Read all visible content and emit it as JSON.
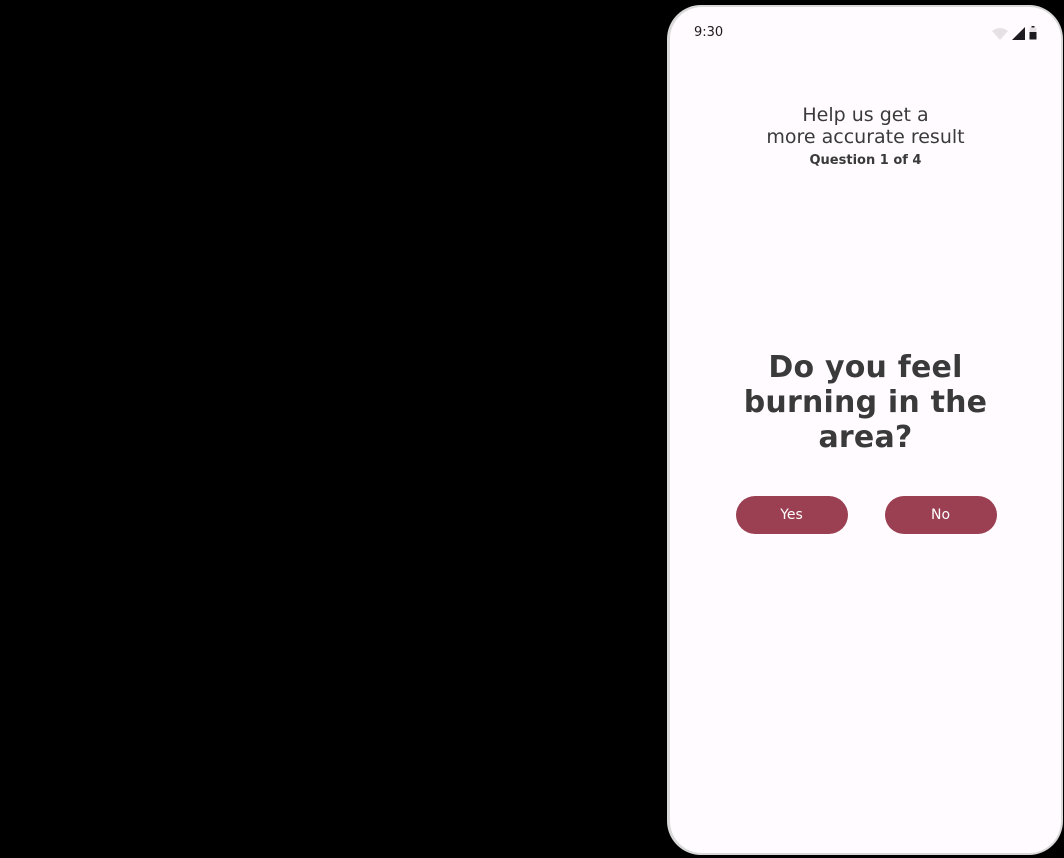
{
  "status_bar": {
    "time": "9:30",
    "icons": [
      "wifi-icon",
      "signal-icon",
      "battery-icon"
    ]
  },
  "header": {
    "title": "Help us get a\nmore accurate result",
    "progress": "Question 1 of 4"
  },
  "question": {
    "text": "Do you feel burning in the area?"
  },
  "answers": {
    "yes_label": "Yes",
    "no_label": "No"
  },
  "colors": {
    "background": "#000000",
    "screen": "#fffbfe",
    "accent": "#9b3f52",
    "text": "#3a3a3a"
  }
}
